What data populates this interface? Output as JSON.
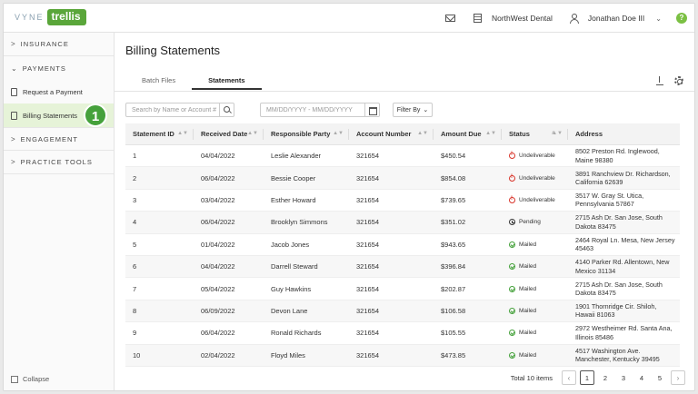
{
  "header": {
    "logo_vyne": "VYNE",
    "logo_trellis": "trellis",
    "practice_name": "NorthWest Dental",
    "user_name": "Jonathan Doe III",
    "help_label": "?"
  },
  "sidebar": {
    "sections": [
      {
        "label": "INSURANCE"
      },
      {
        "label": "PAYMENTS"
      },
      {
        "label": "ENGAGEMENT"
      },
      {
        "label": "PRACTICE TOOLS"
      }
    ],
    "items": [
      {
        "label": "Request a Payment"
      },
      {
        "label": "Billing Statements"
      }
    ],
    "step_badge": "1",
    "collapse_label": "Collapse"
  },
  "main": {
    "title": "Billing Statements",
    "tabs": [
      {
        "label": "Batch Files",
        "active": false
      },
      {
        "label": "Statements",
        "active": true
      }
    ],
    "search_placeholder": "Search by Name or Account #",
    "date_placeholder": "MM/DD/YYYY - MM/DD/YYYY",
    "filter_label": "Filter By",
    "filter_caret": "⌄"
  },
  "table": {
    "columns": [
      "Statement ID",
      "Received Date",
      "Responsible Party",
      "Account Number",
      "Amount Due",
      "Status",
      "Address"
    ],
    "rows": [
      {
        "id": "1",
        "date": "04/04/2022",
        "party": "Leslie Alexander",
        "account": "321654",
        "amount": "$450.54",
        "status": "Undeliverable",
        "address": "8502 Preston Rd. Inglewood, Maine 98380"
      },
      {
        "id": "2",
        "date": "06/04/2022",
        "party": "Bessie Cooper",
        "account": "321654",
        "amount": "$854.08",
        "status": "Undeliverable",
        "address": "3891 Ranchview Dr. Richardson, California 62639"
      },
      {
        "id": "3",
        "date": "03/04/2022",
        "party": "Esther Howard",
        "account": "321654",
        "amount": "$739.65",
        "status": "Undeliverable",
        "address": "3517 W. Gray St. Utica, Pennsylvania 57867"
      },
      {
        "id": "4",
        "date": "06/04/2022",
        "party": "Brooklyn Simmons",
        "account": "321654",
        "amount": "$351.02",
        "status": "Pending",
        "address": "2715 Ash Dr. San Jose, South Dakota 83475"
      },
      {
        "id": "5",
        "date": "01/04/2022",
        "party": "Jacob Jones",
        "account": "321654",
        "amount": "$943.65",
        "status": "Mailed",
        "address": "2464 Royal Ln. Mesa, New Jersey 45463"
      },
      {
        "id": "6",
        "date": "04/04/2022",
        "party": "Darrell Steward",
        "account": "321654",
        "amount": "$396.84",
        "status": "Mailed",
        "address": "4140 Parker Rd. Allentown, New Mexico 31134"
      },
      {
        "id": "7",
        "date": "05/04/2022",
        "party": "Guy Hawkins",
        "account": "321654",
        "amount": "$202.87",
        "status": "Mailed",
        "address": "2715 Ash Dr. San Jose, South Dakota 83475"
      },
      {
        "id": "8",
        "date": "06/09/2022",
        "party": "Devon Lane",
        "account": "321654",
        "amount": "$106.58",
        "status": "Mailed",
        "address": "1901 Thornridge Cir. Shiloh, Hawaii 81063"
      },
      {
        "id": "9",
        "date": "06/04/2022",
        "party": "Ronald Richards",
        "account": "321654",
        "amount": "$105.55",
        "status": "Mailed",
        "address": "2972 Westheimer Rd. Santa Ana, Illinois 85486"
      },
      {
        "id": "10",
        "date": "02/04/2022",
        "party": "Floyd Miles",
        "account": "321654",
        "amount": "$473.85",
        "status": "Mailed",
        "address": "4517 Washington Ave. Manchester, Kentucky 39495"
      }
    ]
  },
  "pagination": {
    "total_label": "Total 10 items",
    "pages": [
      "1",
      "2",
      "3",
      "4",
      "5"
    ],
    "current": "1",
    "prev": "‹",
    "next": "›"
  },
  "colors": {
    "brand_green": "#5aa63a",
    "active_nav_bg": "#e6f3d8",
    "undeliverable": "#d9352b",
    "mailed": "#45a13b"
  }
}
